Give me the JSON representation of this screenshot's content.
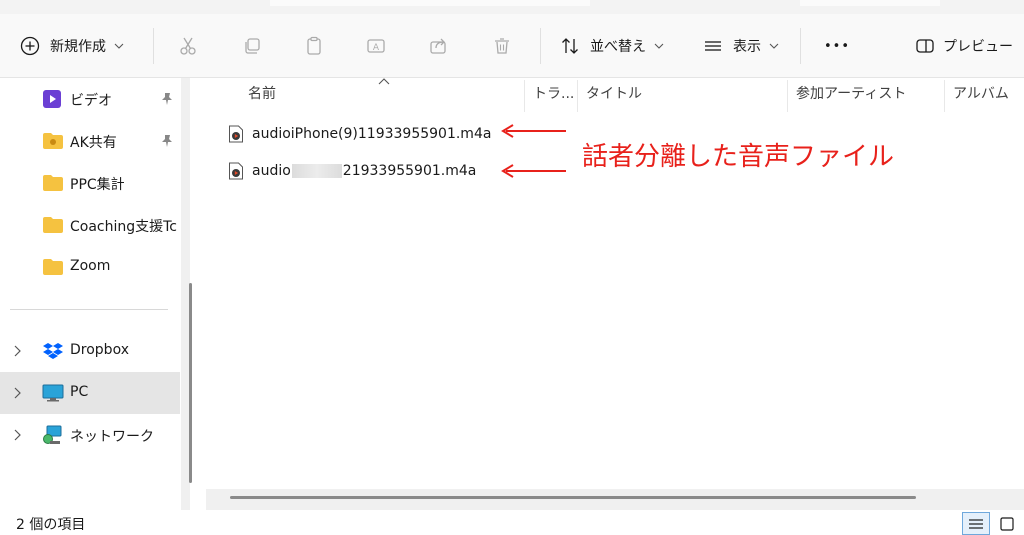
{
  "toolbar": {
    "new_label": "新規作成",
    "sort_label": "並べ替え",
    "view_label": "表示",
    "more_label": "•••",
    "preview_label": "プレビュー"
  },
  "sidebar": {
    "items": [
      {
        "label": "ビデオ",
        "icon": "video-folder-icon",
        "pinned": true
      },
      {
        "label": "AK共有",
        "icon": "folder-icon",
        "pinned": true
      },
      {
        "label": "PPC集計",
        "icon": "folder-icon",
        "pinned": false
      },
      {
        "label": "Coaching支援Tc",
        "icon": "folder-icon",
        "pinned": false
      },
      {
        "label": "Zoom",
        "icon": "folder-icon",
        "pinned": false
      }
    ],
    "locations": [
      {
        "label": "Dropbox",
        "icon": "dropbox-icon",
        "selected": false
      },
      {
        "label": "PC",
        "icon": "monitor-icon",
        "selected": true
      },
      {
        "label": "ネットワーク",
        "icon": "network-icon",
        "selected": false
      }
    ]
  },
  "columns": {
    "name": "名前",
    "track": "トラ...",
    "title": "タイトル",
    "artist": "参加アーティスト",
    "album": "アルバム"
  },
  "files": [
    {
      "name_a": "audioiPhone(9)11933955901.m4a",
      "name_b": ""
    },
    {
      "name_a": "audio",
      "name_b": "21933955901.m4a"
    }
  ],
  "annotation": {
    "text": "話者分離した音声ファイル",
    "color": "#e8211b"
  },
  "status": {
    "item_count": "2 個の項目"
  },
  "colors": {
    "folder": "#f5c240",
    "selection": "#e5e5e5",
    "accent": "#0067c0"
  }
}
